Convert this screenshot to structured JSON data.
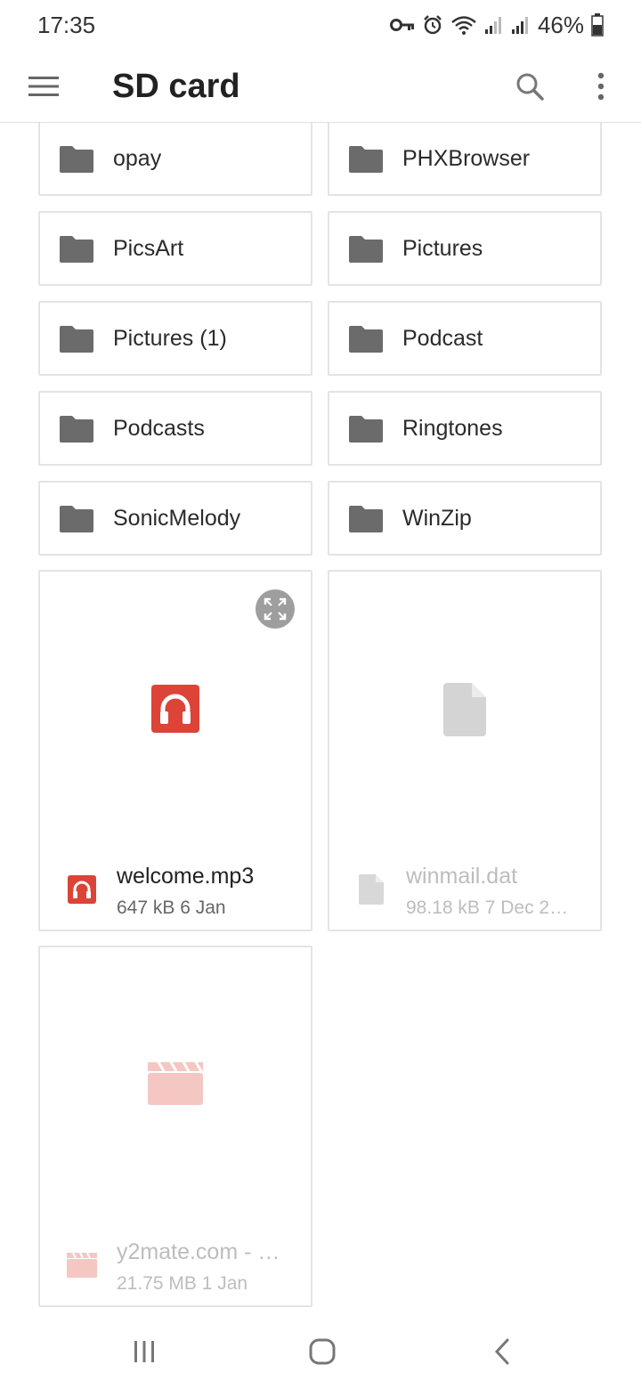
{
  "status_bar": {
    "time": "17:35",
    "battery": "46%"
  },
  "app_bar": {
    "title": "SD card",
    "icons": [
      "menu-icon",
      "search-icon",
      "more-vertical-icon"
    ]
  },
  "folders": [
    {
      "name": "opay"
    },
    {
      "name": "PHXBrowser"
    },
    {
      "name": "PicsArt"
    },
    {
      "name": "Pictures"
    },
    {
      "name": "Pictures (1)"
    },
    {
      "name": "Podcast"
    },
    {
      "name": "Podcasts"
    },
    {
      "name": "Ringtones"
    },
    {
      "name": "SonicMelody"
    },
    {
      "name": "WinZip"
    }
  ],
  "files": [
    {
      "name": "welcome.mp3",
      "meta": "647 kB 6 Jan",
      "type": "audio",
      "accent": "#db4437"
    },
    {
      "name": "winmail.dat",
      "meta": "98.18 kB 7 Dec 2…",
      "type": "generic",
      "accent": "#d0d0d0"
    },
    {
      "name": "y2mate.com - …",
      "meta": "21.75 MB 1 Jan",
      "type": "video",
      "accent": "#f4c7c3"
    }
  ],
  "colors": {
    "folder_icon": "#6b6b6b",
    "border": "#e4e4e4"
  },
  "nav_bar": {
    "icons": [
      "recent-apps-icon",
      "home-icon",
      "back-icon"
    ]
  }
}
